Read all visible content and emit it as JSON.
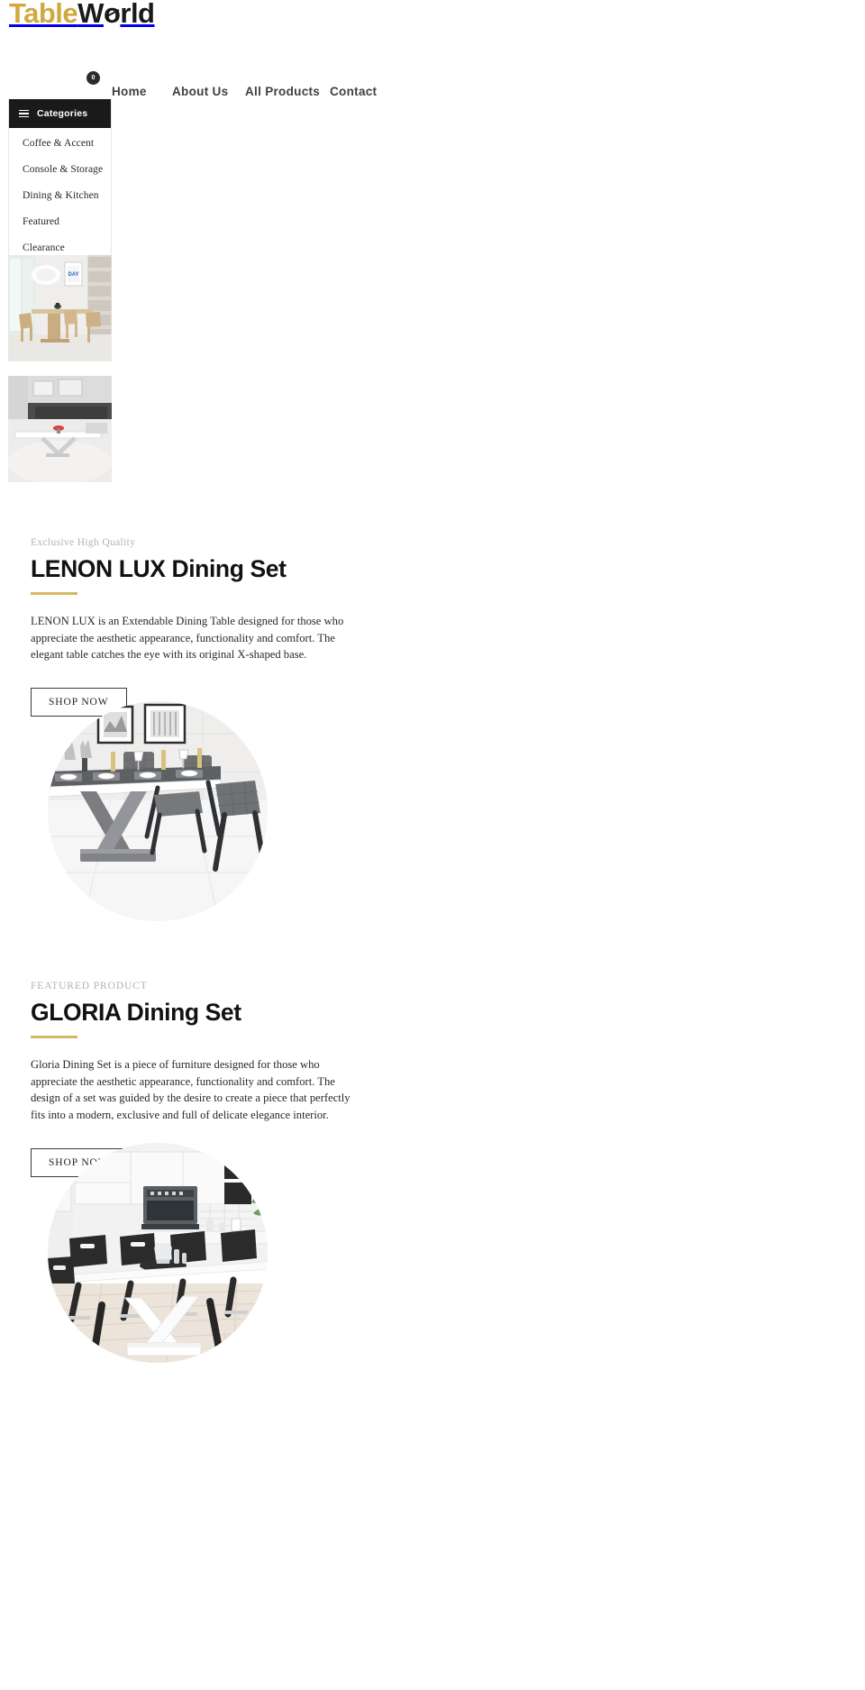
{
  "brand": {
    "name_part1": "Table",
    "name_part2_a": "W",
    "name_part2_o": "o",
    "name_part2_b": "rld"
  },
  "nav": {
    "home": "Home",
    "about": "About Us",
    "products": "All Products",
    "contact": "Contact"
  },
  "cart": {
    "count": "0"
  },
  "categories": {
    "header_label": "Categories",
    "items": [
      {
        "label": "Coffee & Accent"
      },
      {
        "label": "Console & Storage"
      },
      {
        "label": "Dining & Kitchen"
      },
      {
        "label": "Featured"
      },
      {
        "label": "Clearance"
      }
    ]
  },
  "thumbnails": [
    {
      "alt": "wooden-dining-set-bright-room"
    },
    {
      "alt": "white-x-base-table-living-room"
    }
  ],
  "sections": [
    {
      "eyebrow": "Exclusive High Quality",
      "title": "LENON LUX Dining Set",
      "description": "LENON LUX is an Extendable Dining Table designed for those who appreciate the aesthetic appearance, functionality and comfort. The elegant table catches the eye with its original X-shaped base.",
      "cta": "SHOP NOW",
      "image_alt": "lenon-lux-dining-table-grey-chairs"
    },
    {
      "eyebrow": "FEATURED PRODUCT",
      "title": "GLORIA Dining Set",
      "description": "Gloria Dining Set is a piece of furniture designed for those who appreciate the aesthetic appearance, functionality and comfort. The design of a set was guided by the desire to create a piece that perfectly fits into a modern, exclusive and full of delicate elegance interior.",
      "cta": "SHOP NOW",
      "image_alt": "gloria-white-dining-table-modern-kitchen"
    }
  ],
  "colors": {
    "gold": "#d4b863",
    "logo_gold": "#cfa93f",
    "dark": "#1a1a1a",
    "muted": "#b2b2b2"
  }
}
